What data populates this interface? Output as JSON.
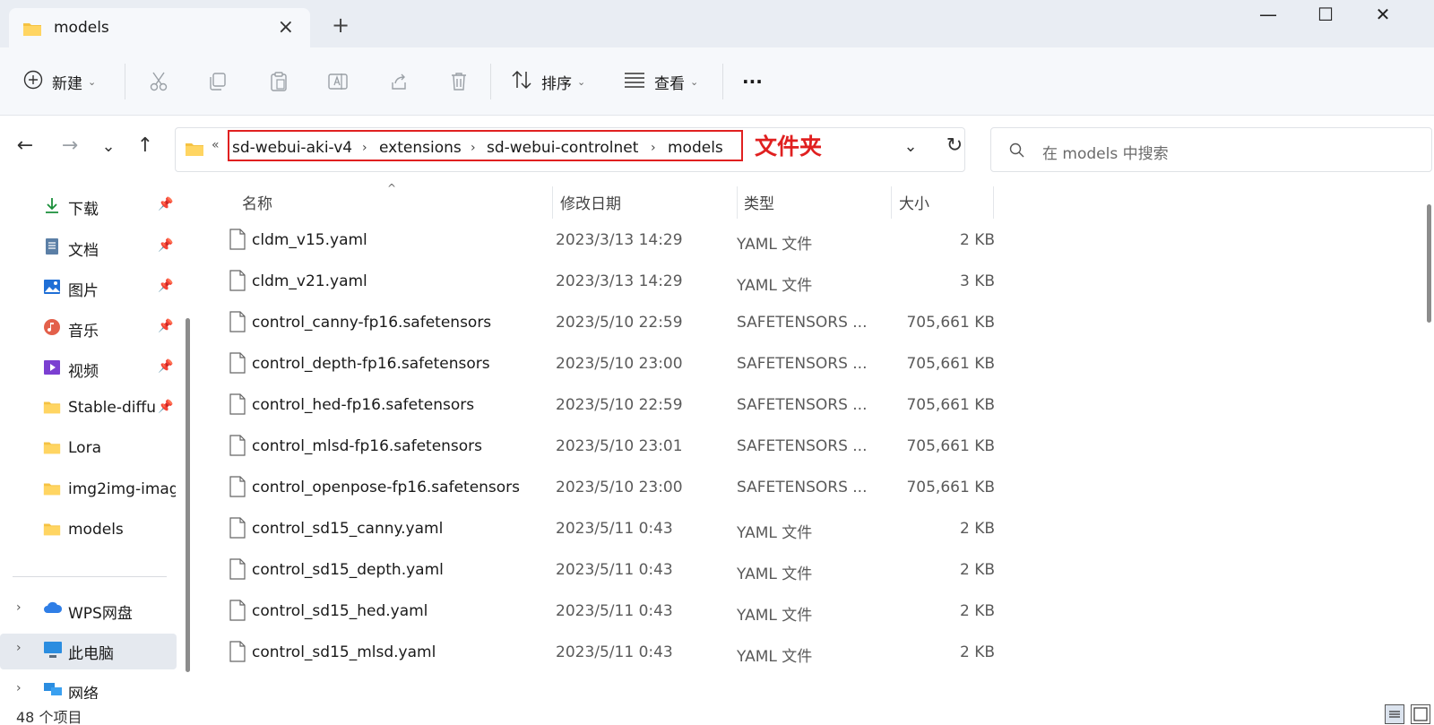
{
  "window": {
    "tab_title": "models",
    "new_tab_label": "+",
    "minimize_label": "—",
    "maximize_label": "☐",
    "close_label": "✕"
  },
  "toolbar": {
    "new_label": "新建",
    "sort_label": "排序",
    "view_label": "查看",
    "more_label": "···"
  },
  "address": {
    "overflow_marker": "«",
    "breadcrumbs": [
      "sd-webui-aki-v4",
      "extensions",
      "sd-webui-controlnet",
      "models"
    ],
    "annotation": "文件夹",
    "search_placeholder": "在 models 中搜索"
  },
  "sidebar": {
    "quick_access": [
      {
        "label": "下载",
        "icon": "download-icon",
        "pinned": true
      },
      {
        "label": "文档",
        "icon": "documents-icon",
        "pinned": true
      },
      {
        "label": "图片",
        "icon": "pictures-icon",
        "pinned": true
      },
      {
        "label": "音乐",
        "icon": "music-icon",
        "pinned": true
      },
      {
        "label": "视频",
        "icon": "videos-icon",
        "pinned": true
      },
      {
        "label": "Stable-diffu",
        "icon": "folder-icon",
        "pinned": true
      },
      {
        "label": "Lora",
        "icon": "folder-icon",
        "pinned": false
      },
      {
        "label": "img2img-imag",
        "icon": "folder-icon",
        "pinned": false
      },
      {
        "label": "models",
        "icon": "folder-icon",
        "pinned": false
      }
    ],
    "locations": [
      {
        "label": "WPS网盘",
        "icon": "cloud-icon",
        "selected": false
      },
      {
        "label": "此电脑",
        "icon": "computer-icon",
        "selected": true
      },
      {
        "label": "网络",
        "icon": "network-icon",
        "selected": false
      }
    ]
  },
  "columns": {
    "name": "名称",
    "date": "修改日期",
    "type": "类型",
    "size": "大小"
  },
  "files": [
    {
      "name": "cldm_v15.yaml",
      "date": "2023/3/13 14:29",
      "type": "YAML 文件",
      "size": "2 KB"
    },
    {
      "name": "cldm_v21.yaml",
      "date": "2023/3/13 14:29",
      "type": "YAML 文件",
      "size": "3 KB"
    },
    {
      "name": "control_canny-fp16.safetensors",
      "date": "2023/5/10 22:59",
      "type": "SAFETENSORS ...",
      "size": "705,661 KB"
    },
    {
      "name": "control_depth-fp16.safetensors",
      "date": "2023/5/10 23:00",
      "type": "SAFETENSORS ...",
      "size": "705,661 KB"
    },
    {
      "name": "control_hed-fp16.safetensors",
      "date": "2023/5/10 22:59",
      "type": "SAFETENSORS ...",
      "size": "705,661 KB"
    },
    {
      "name": "control_mlsd-fp16.safetensors",
      "date": "2023/5/10 23:01",
      "type": "SAFETENSORS ...",
      "size": "705,661 KB"
    },
    {
      "name": "control_openpose-fp16.safetensors",
      "date": "2023/5/10 23:00",
      "type": "SAFETENSORS ...",
      "size": "705,661 KB"
    },
    {
      "name": "control_sd15_canny.yaml",
      "date": "2023/5/11 0:43",
      "type": "YAML 文件",
      "size": "2 KB"
    },
    {
      "name": "control_sd15_depth.yaml",
      "date": "2023/5/11 0:43",
      "type": "YAML 文件",
      "size": "2 KB"
    },
    {
      "name": "control_sd15_hed.yaml",
      "date": "2023/5/11 0:43",
      "type": "YAML 文件",
      "size": "2 KB"
    },
    {
      "name": "control_sd15_mlsd.yaml",
      "date": "2023/5/11 0:43",
      "type": "YAML 文件",
      "size": "2 KB"
    }
  ],
  "status": {
    "item_count": "48 个项目"
  },
  "colors": {
    "accent": "#0067c0",
    "annotation_red": "#e02020",
    "folder_yellow": "#f5c242"
  }
}
